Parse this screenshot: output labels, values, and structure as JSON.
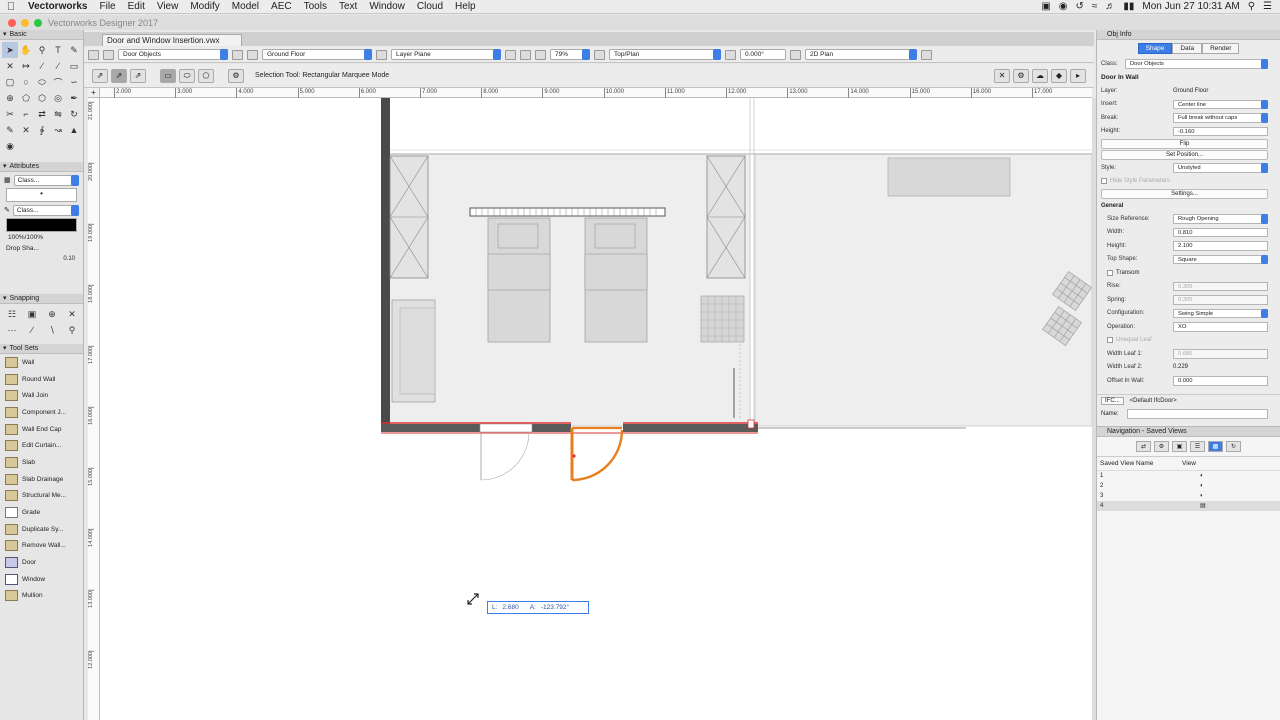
{
  "menubar": {
    "app": "Vectorworks",
    "items": [
      "File",
      "Edit",
      "View",
      "Modify",
      "Model",
      "AEC",
      "Tools",
      "Text",
      "Window",
      "Cloud",
      "Help"
    ],
    "clock": "Mon Jun 27  10:31 AM"
  },
  "window": {
    "title": "Vectorworks Designer 2017"
  },
  "document": {
    "tab": "Door and Window Insertion.vwx"
  },
  "viewbar": {
    "class": "Door Objects",
    "layer": "Ground Floor",
    "plane": "Layer Plane",
    "zoom": "79%",
    "view": "Top/Plan",
    "rotation": "0.000°",
    "render": "2D Plan"
  },
  "modebar": {
    "message": "Selection Tool: Rectangular Marquee Mode"
  },
  "palettes": {
    "basic": "Basic",
    "attributes": "Attributes",
    "snapping": "Snapping",
    "toolsets": "Tool Sets",
    "attr_class_1": "Class...",
    "attr_class_2": "Class...",
    "opacity": "100%/100%",
    "drop_shadow": "Drop Sha...",
    "line_weight": "0.10"
  },
  "toolset_items": [
    "Wall",
    "Round Wall",
    "Wall Join",
    "Component J...",
    "Wall End Cap",
    "Edit Curtain...",
    "Slab",
    "Slab Drainage",
    "Structural Me...",
    "Grade",
    "Duplicate Sy...",
    "Remove Wall...",
    "Door",
    "Window",
    "Mullion"
  ],
  "ruler": {
    "h": [
      "2.000",
      "3.000",
      "4.000",
      "5.000",
      "6.000",
      "7.000",
      "8.000",
      "9.000",
      "10.000",
      "11.000",
      "12.000",
      "13.000",
      "14.000",
      "15.000",
      "16.000",
      "17.000"
    ],
    "v": [
      "21.000",
      "20.000",
      "19.000",
      "18.000",
      "17.000",
      "16.000",
      "15.000",
      "14.000",
      "13.000",
      "12.000"
    ]
  },
  "cursor_readout": {
    "l": "L:",
    "l_val": "2.680",
    "a": "A:",
    "a_val": "-123.792°"
  },
  "objinfo": {
    "panel_title": "Obj Info",
    "tabs": [
      "Shape",
      "Data",
      "Render"
    ],
    "class_label": "Class:",
    "class_value": "Door Objects",
    "object_title": "Door In Wall",
    "layer_label": "Layer:",
    "layer_value": "Ground Floor",
    "insert_label": "Insert:",
    "insert_value": "Center line",
    "break_label": "Break:",
    "break_value": "Full break without caps",
    "height_label": "Height:",
    "height_value": "-0.160",
    "flip": "Flip",
    "set_position": "Set Position...",
    "style_label": "Style:",
    "style_value": "Unstyled",
    "hide_style": "Hide Style Parameters",
    "settings": "Settings...",
    "general": "General",
    "size_ref_label": "Size Reference:",
    "size_ref_value": "Rough Opening",
    "width_label": "Width:",
    "width_value": "0.810",
    "height2_label": "Height:",
    "height2_value": "2.100",
    "top_shape_label": "Top Shape:",
    "top_shape_value": "Square",
    "transom": "Transom",
    "rise_label": "Rise:",
    "rise_value": "0.305",
    "spring_label": "Spring:",
    "spring_value": "0.305",
    "config_label": "Configuration:",
    "config_value": "Swing Simple",
    "operation_label": "Operation:",
    "operation_value": "XO",
    "unequal_leaf": "Unequal Leaf",
    "leaf1_label": "Width Leaf 1:",
    "leaf1_value": "0.686",
    "leaf2_label": "Width Leaf 2:",
    "leaf2_value": "0.229",
    "offset_label": "Offset In Wall:",
    "offset_value": "0.000",
    "ifc_button": "IFC...",
    "ifc_value": "<Default IfcDoor>",
    "name_label": "Name:"
  },
  "navigation": {
    "title": "Navigation - Saved Views",
    "col1": "Saved View Name",
    "col2": "View",
    "rows": [
      "1",
      "2",
      "3",
      "4"
    ]
  },
  "colors": {
    "accent": "#3d7ee6",
    "door_highlight": "#e87f1e",
    "wall_select": "#e03030"
  }
}
